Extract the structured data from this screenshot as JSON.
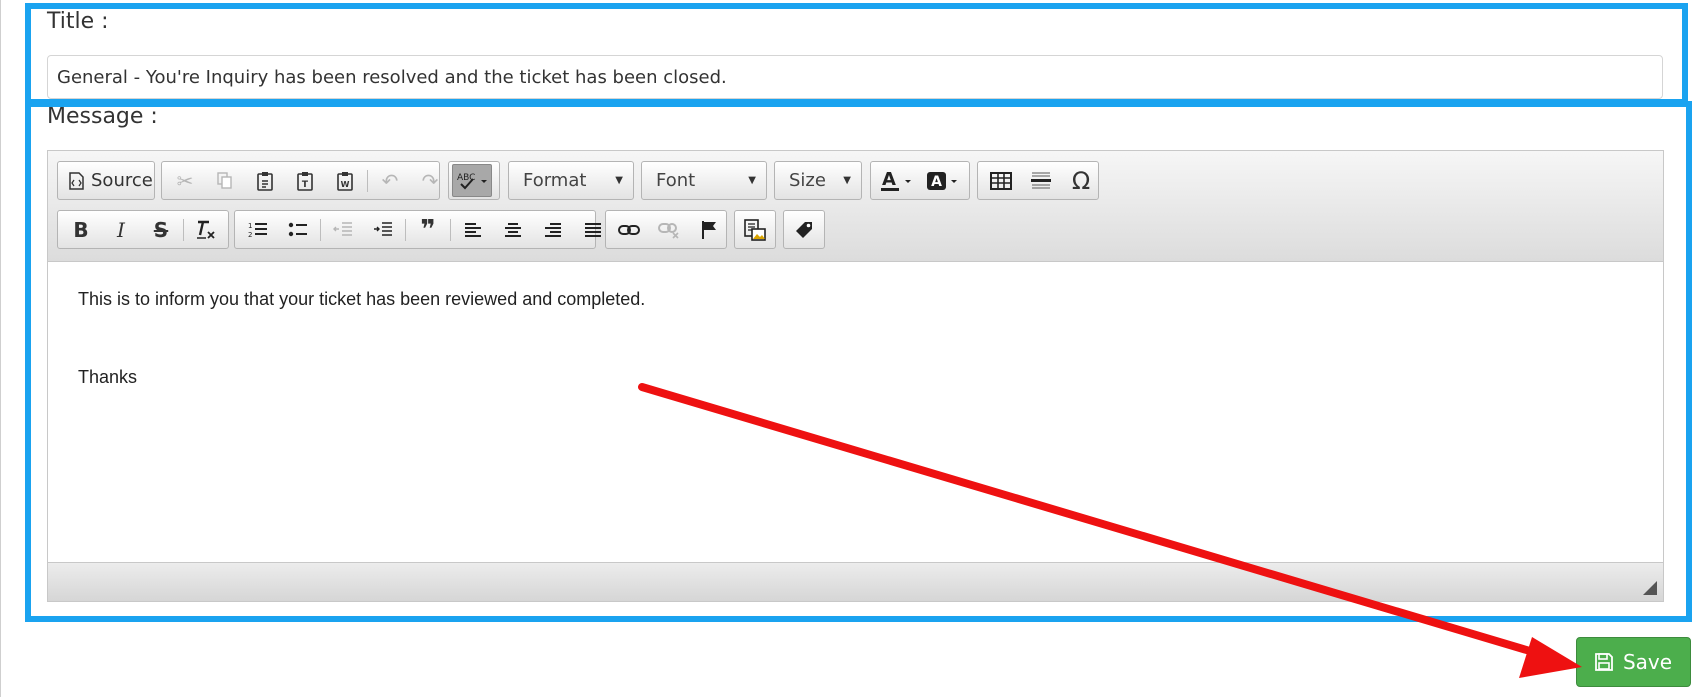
{
  "title_field": {
    "label": "Title :",
    "value": "General - You're Inquiry has been resolved and the ticket has been closed."
  },
  "message_field": {
    "label": "Message :"
  },
  "toolbar": {
    "source_label": "Source",
    "format_label": "Format",
    "font_label": "Font",
    "size_label": "Size"
  },
  "editor_content": {
    "line1": "This is to inform you that your ticket has been reviewed and completed.",
    "line2": "Thanks"
  },
  "save_button": {
    "label": "Save"
  },
  "colors": {
    "highlight": "#1aa3f0",
    "arrow": "#ee1111",
    "save": "#4cae4c"
  }
}
